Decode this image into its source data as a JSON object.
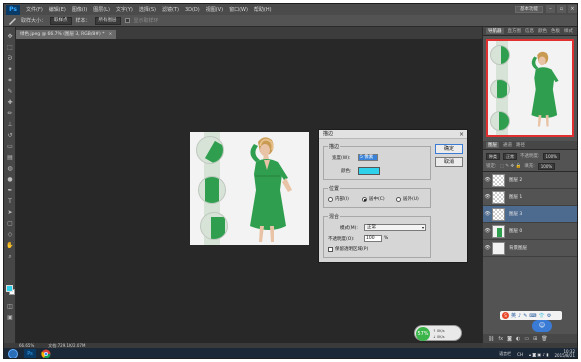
{
  "app": {
    "logo": "Ps",
    "menu": [
      "文件(F)",
      "编辑(E)",
      "图像(I)",
      "图层(L)",
      "文字(Y)",
      "选择(S)",
      "滤镜(T)",
      "3D(D)",
      "视图(V)",
      "窗口(W)",
      "帮助(H)"
    ],
    "workspace": "基本功能",
    "window_controls": [
      "–",
      "▫",
      "×"
    ]
  },
  "options_bar": {
    "tool_icon": "brush-icon",
    "size_label": "取样大小：",
    "size_value": "取样点",
    "sample_label": "样本：",
    "sample_value": "所有图层",
    "ring_label": "显示取样环"
  },
  "doc_tab": {
    "title": "绿色.jpeg @ 66.7% (图层 3, RGB/8#) *",
    "close": "×"
  },
  "status_bar": {
    "zoom": "66.65%",
    "doc_info": "文档:729.1K/2.07M"
  },
  "navigator_panel": {
    "tabs": [
      "导航器",
      "直方图",
      "信息",
      "颜色",
      "色板",
      "样式"
    ],
    "active_tab": "导航器"
  },
  "layers_panel": {
    "tabs": [
      "图层",
      "通道",
      "路径"
    ],
    "kind_label": "种类",
    "blend_mode": "正常",
    "opacity_label": "不透明度:",
    "opacity_value": "100%",
    "lock_label": "锁定:",
    "fill_label": "填充:",
    "fill_value": "100%",
    "layers": [
      {
        "name": "图层 2",
        "selected": false,
        "thumb": "checker"
      },
      {
        "name": "图层 1",
        "selected": false,
        "thumb": "checker"
      },
      {
        "name": "图层 3",
        "selected": true,
        "thumb": "checker"
      },
      {
        "name": "图层 0",
        "selected": false,
        "thumb": "photo"
      },
      {
        "name": "背景图层",
        "selected": false,
        "thumb": "white"
      }
    ],
    "footer_icons": [
      "link-icon",
      "fx-icon",
      "mask-icon",
      "adjustment-icon",
      "folder-icon",
      "new-layer-icon",
      "trash-icon"
    ]
  },
  "dialog": {
    "title": "描边",
    "close": "×",
    "stroke_group": "描边",
    "width_label": "宽度(W):",
    "width_value": "5 像素",
    "color_label": "颜色:",
    "color_value": "#2fd2ea",
    "position_group": "位置",
    "position_options": [
      "内部(I)",
      "居中(C)",
      "居外(U)"
    ],
    "position_selected": 1,
    "blend_group": "混合",
    "mode_label": "模式(M):",
    "mode_value": "正常",
    "opacity_label": "不透明度(O):",
    "opacity_value": "100",
    "opacity_unit": "%",
    "preserve_label": "保留透明区域(P)",
    "ok_label": "确定",
    "cancel_label": "取消"
  },
  "taskbar": {
    "apps": [
      "Ps",
      "chrome"
    ],
    "tray_items": [
      "语言栏",
      "CH"
    ],
    "time": "10:32",
    "date": "2015/8/21"
  },
  "net_widget": {
    "percent": "57%",
    "up": "0K/s",
    "down": "0K/s"
  },
  "ime_bar": {
    "label": "S",
    "items": [
      "英",
      "♪",
      "✎",
      "⌨",
      "👕",
      "⚙"
    ]
  },
  "colors": {
    "accent": "#2fd2ea",
    "dress": "#2f9f4f",
    "selection": "#4d6a8f",
    "nav_frame": "#e03030"
  }
}
